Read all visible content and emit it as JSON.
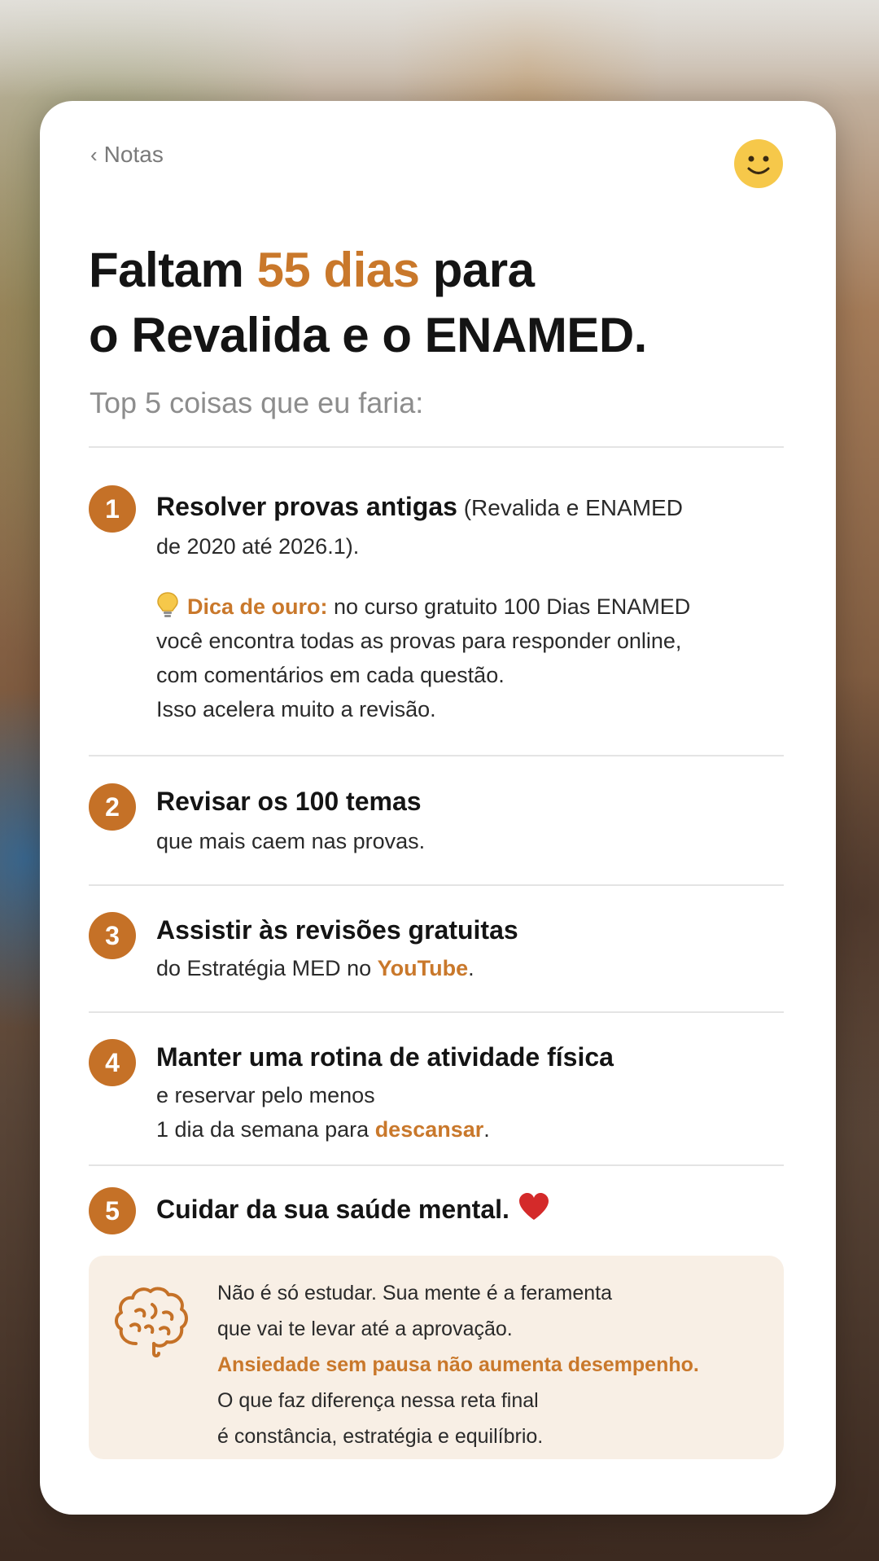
{
  "header": {
    "back_label": "Notas",
    "avatar_icon": "smiley-face-icon"
  },
  "title": {
    "part1": "Faltam ",
    "highlight": "55 dias",
    "part2": " para",
    "line2": "o Revalida e o ENAMED."
  },
  "subtitle": "Top 5 coisas que eu faria:",
  "items": [
    {
      "number": "1",
      "title": "Resolver provas antigas",
      "title_suffix": " (Revalida e ENAMED",
      "lines": [
        "de 2020 até 2026.1)."
      ],
      "tip": {
        "icon": "lightbulb-icon",
        "label": "Dica de ouro:",
        "first_line": " no curso gratuito 100 Dias ENAMED",
        "lines": [
          "você encontra todas as provas para responder online,",
          "com comentários em cada questão.",
          "Isso acelera muito a revisão."
        ]
      }
    },
    {
      "number": "2",
      "title": "Revisar os 100 temas",
      "lines": [
        "que mais caem nas provas."
      ]
    },
    {
      "number": "3",
      "title": "Assistir às revisões gratuitas",
      "line_prefix": "do Estratégia MED no ",
      "line_highlight": "YouTube",
      "line_suffix": "."
    },
    {
      "number": "4",
      "title": "Manter uma rotina de atividade física",
      "line1": "e reservar pelo menos",
      "line2_prefix": "1 dia da semana para ",
      "line2_highlight": "descansar",
      "line2_suffix": "."
    },
    {
      "number": "5",
      "title": "Cuidar da sua saúde mental.",
      "icon": "heart-icon"
    }
  ],
  "callout": {
    "icon": "brain-icon",
    "line1": "Não é só estudar. Sua mente é a feramenta",
    "line2": "que vai te levar até a aprovação.",
    "highlight": "Ansiedade sem pausa não aumenta desempenho.",
    "line4": "O que faz diferença nessa reta final",
    "line5": "é constância, estratégia e equilíbrio."
  },
  "colors": {
    "accent": "#c9782b",
    "badge": "#c57127",
    "callout_bg": "#f8efe5"
  }
}
